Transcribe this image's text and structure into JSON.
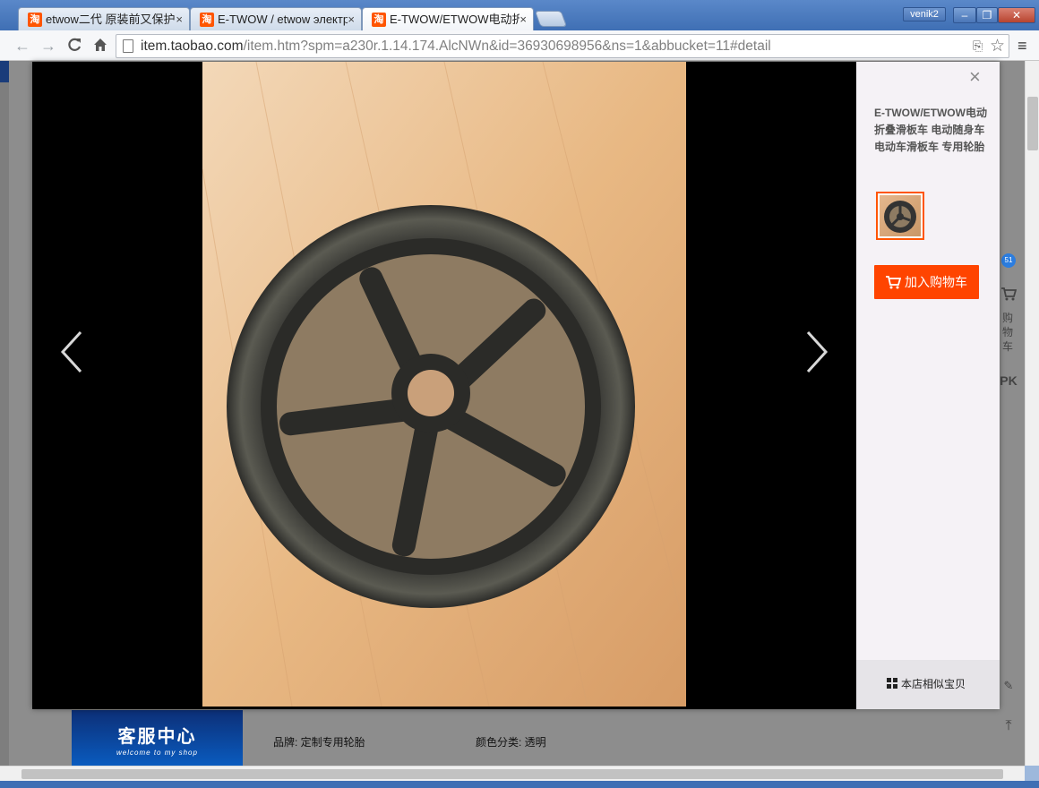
{
  "tabs": [
    {
      "label": "etwow二代 原装前又保护",
      "favicon": "淘",
      "close": "×"
    },
    {
      "label": "E-TWOW / etwow электри",
      "favicon": "淘",
      "close": "×"
    },
    {
      "label": "E-TWOW/ETWOW电动折叠",
      "favicon": "淘",
      "close": "×",
      "active": true
    }
  ],
  "window": {
    "user": "venik2",
    "min": "–",
    "restore": "❐",
    "close": "✕"
  },
  "toolbar": {
    "back": "←",
    "forward": "→",
    "reload": "C",
    "home": "⌂",
    "url_host": "item.taobao.com",
    "url_rest": "/item.htm?spm=a230r.1.14.174.AlcNWn&id=36930698956&ns=1&abbucket=11#detail",
    "translate_icon": "translate-icon",
    "star": "☆",
    "menu": "≡"
  },
  "lightbox": {
    "close": "×",
    "title": "E-TWOW/ETWOW电动折叠滑板车 电动随身车 电动车滑板车 专用轮胎",
    "cart_button": "加入购物车",
    "similar": "本店相似宝贝",
    "prev_arrow": "chevron-left-icon",
    "next_arrow": "chevron-right-icon"
  },
  "page": {
    "banner_title": "客服中心",
    "banner_sub": "welcome to my shop",
    "brand": "品牌: 定制专用轮胎",
    "color": "颜色分类: 透明",
    "right_cart": "购物车",
    "right_badge": "51",
    "right_pk": "PK"
  },
  "colors": {
    "accent": "#ff4400",
    "tab_bar": "#3f6fb4"
  }
}
